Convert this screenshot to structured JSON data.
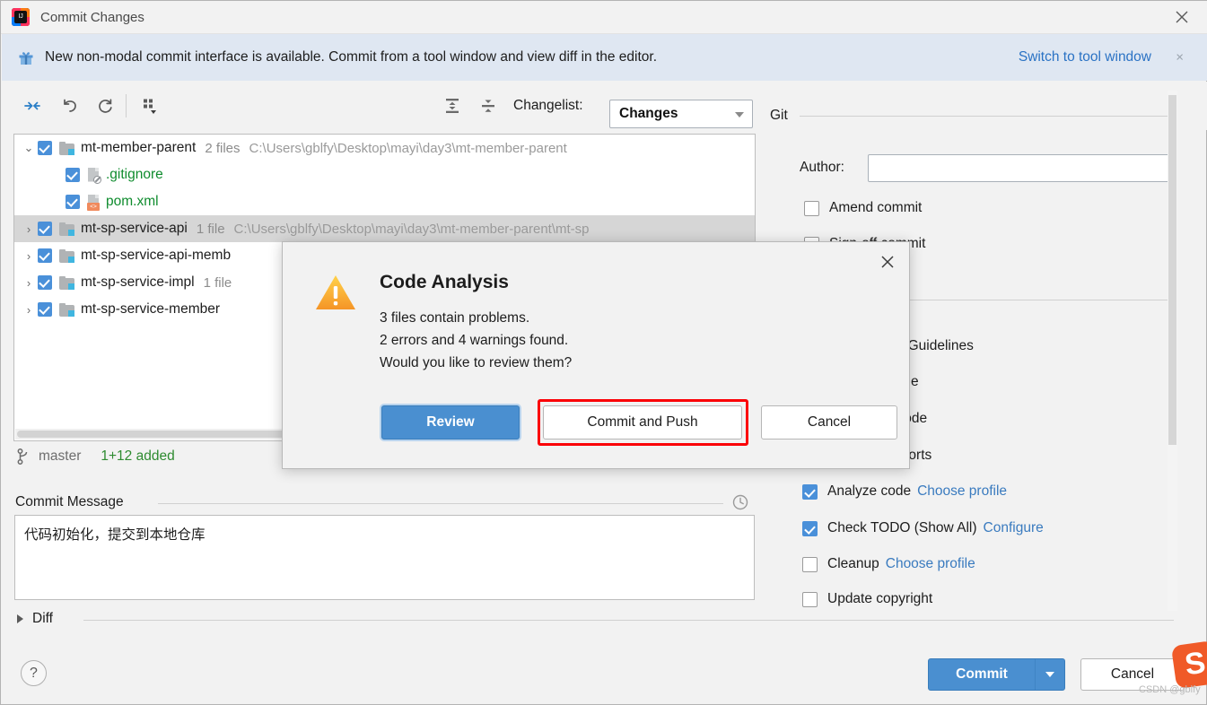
{
  "window": {
    "title": "Commit Changes",
    "logo_text": "IJ",
    "close_icon": "close-icon"
  },
  "banner": {
    "icon": "gift-icon",
    "text": "New non-modal commit interface is available. Commit from a tool window and view diff in the editor.",
    "link": "Switch to tool window",
    "close": "×"
  },
  "toolbar": {
    "icons": [
      {
        "name": "collapse-arrows-icon",
        "title": "Show Diff"
      },
      {
        "name": "rollback-icon",
        "title": "Rollback"
      },
      {
        "name": "refresh-icon",
        "title": "Refresh"
      },
      {
        "name": "group-by-icon",
        "title": "Group By"
      },
      {
        "name": "expand-all-icon",
        "title": "Expand All"
      },
      {
        "name": "collapse-all-icon",
        "title": "Collapse All"
      }
    ],
    "changelist_label": "Changelist:",
    "changelist_value": "Changes"
  },
  "tree": {
    "rows": [
      {
        "indent": 0,
        "twisty": "⌄",
        "expanded": true,
        "checked": true,
        "icon": "module-folder-icon",
        "name": "mt-member-parent",
        "name_color": "normal",
        "count": "2 files",
        "path": "C:\\Users\\gblfy\\Desktop\\mayi\\day3\\mt-member-parent",
        "selected": false
      },
      {
        "indent": 1,
        "twisty": "",
        "checked": true,
        "icon": "gitignore-file-icon",
        "name": ".gitignore",
        "name_color": "green",
        "count": "",
        "path": "",
        "selected": false
      },
      {
        "indent": 1,
        "twisty": "",
        "checked": true,
        "icon": "xml-file-icon",
        "name": "pom.xml",
        "name_color": "green",
        "count": "",
        "path": "",
        "selected": false
      },
      {
        "indent": 0,
        "twisty": "›",
        "expanded": false,
        "checked": true,
        "icon": "module-folder-icon",
        "name": "mt-sp-service-api",
        "name_color": "normal",
        "count": "1 file",
        "path": "C:\\Users\\gblfy\\Desktop\\mayi\\day3\\mt-member-parent\\mt-sp",
        "selected": true
      },
      {
        "indent": 0,
        "twisty": "›",
        "expanded": false,
        "checked": true,
        "icon": "module-folder-icon",
        "name": "mt-sp-service-api-memb",
        "name_color": "normal",
        "count": "",
        "path": "",
        "selected": false
      },
      {
        "indent": 0,
        "twisty": "›",
        "expanded": false,
        "checked": true,
        "icon": "module-folder-icon",
        "name": "mt-sp-service-impl",
        "name_color": "normal",
        "count": "1 file",
        "path": "",
        "selected": false
      },
      {
        "indent": 0,
        "twisty": "›",
        "expanded": false,
        "checked": true,
        "icon": "module-folder-icon",
        "name": "mt-sp-service-member",
        "name_color": "normal",
        "count": "",
        "path": "",
        "selected": false
      }
    ]
  },
  "branch": {
    "icon": "git-branch-icon",
    "name": "master",
    "added": "1+12 added"
  },
  "commit_message": {
    "label": "Commit Message",
    "history_icon": "history-clock-icon",
    "value": "代码初始化，提交到本地仓库"
  },
  "diff": {
    "label": "Diff",
    "expanded": false
  },
  "right_panel": {
    "group_title": "Git",
    "author_label": "Author:",
    "author_value": "",
    "amend_commit": {
      "label": "Amend commit",
      "checked": false
    },
    "sign_off_commit": {
      "label": "Sign-off commit",
      "checked": false
    },
    "before_commit_options": [
      {
        "label": "Check Code Guidelines",
        "checked": false,
        "link": ""
      },
      {
        "label": "Reformat code",
        "checked": false,
        "link": ""
      },
      {
        "label": "Rearrange code",
        "checked": false,
        "link": ""
      },
      {
        "label": "Optimize imports",
        "checked": false,
        "link": ""
      },
      {
        "label": "Analyze code",
        "checked": true,
        "link": "Choose profile"
      },
      {
        "label": "Check TODO (Show All)",
        "checked": true,
        "link": "Configure"
      },
      {
        "label": "Cleanup",
        "checked": false,
        "link": "Choose profile"
      },
      {
        "label": "Update copyright",
        "checked": false,
        "link": ""
      }
    ]
  },
  "bottom_bar": {
    "help_label": "?",
    "commit_label": "Commit",
    "commit_dropdown": "dropdown-arrow-icon",
    "cancel_label": "Cancel"
  },
  "modal": {
    "title": "Code Analysis",
    "warning_icon": "warning-triangle-icon",
    "close_icon": "close-icon",
    "line1": "3 files contain problems.",
    "line2": "2 errors and 4 warnings found.",
    "line3": "Would you like to review them?",
    "buttons": {
      "review": "Review",
      "commit_and_push": "Commit and Push",
      "cancel": "Cancel"
    },
    "highlight_color": "#fb0007"
  },
  "watermark": {
    "logo": "S",
    "text": "CSDN @gblfy"
  }
}
